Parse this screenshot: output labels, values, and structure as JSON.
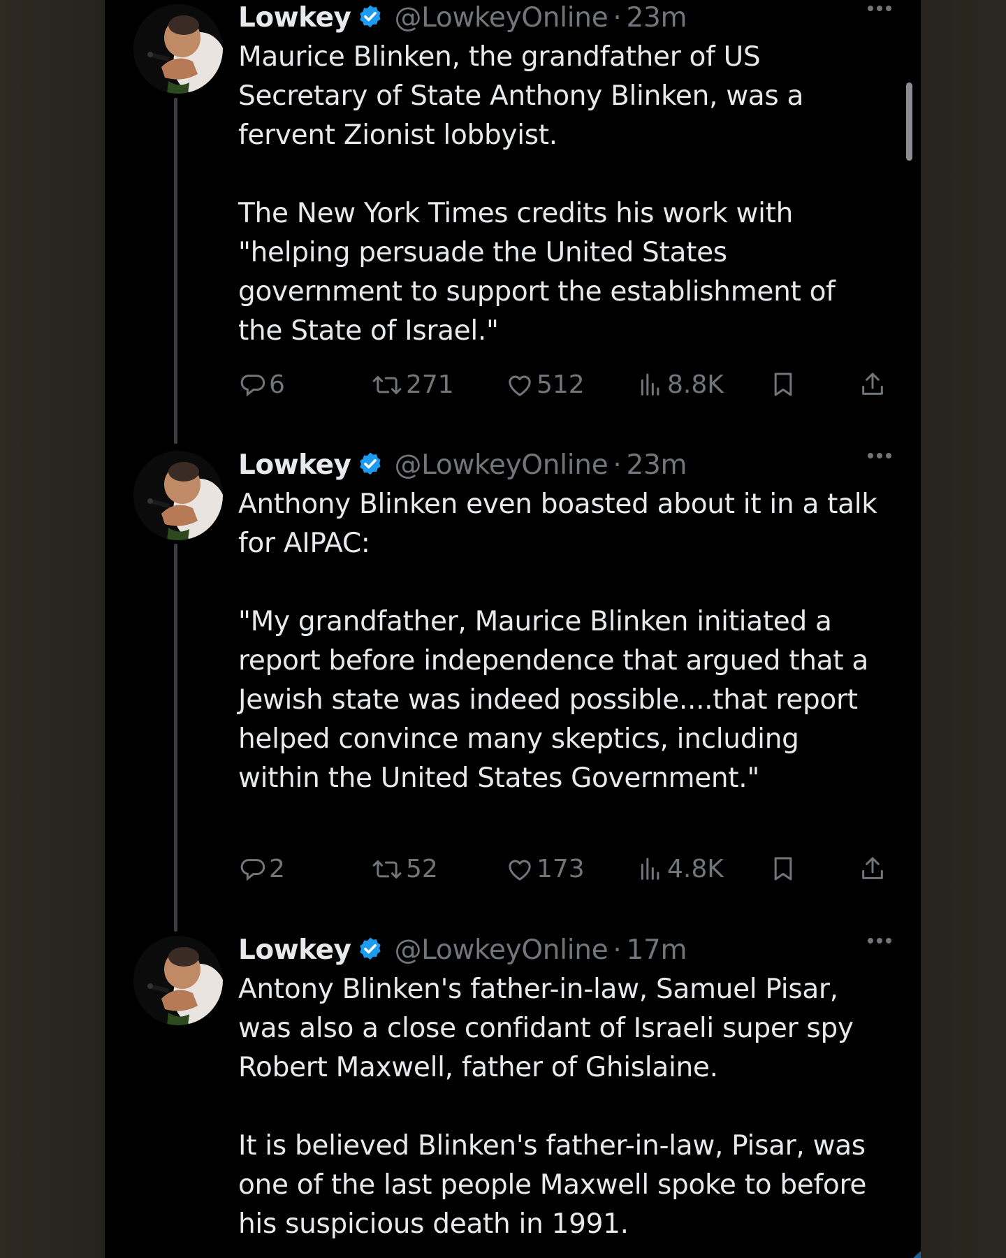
{
  "colors": {
    "background": "#000000",
    "text_primary": "#e7e9ea",
    "text_secondary": "#71767b",
    "verified_blue": "#1d9bf0",
    "thread_line": "#3a3d41"
  },
  "tweets": [
    {
      "author": {
        "name": "Lowkey",
        "handle": "@LowkeyOnline",
        "verified": true
      },
      "separator": "·",
      "time": "23m",
      "paragraphs": [
        "Maurice Blinken, the grandfather of US Secretary of State Anthony Blinken, was a fervent Zionist lobbyist.",
        "The New York Times credits his work with \"helping persuade the United States government to support the establishment of the State of Israel.\""
      ],
      "stats": {
        "replies": "6",
        "reposts": "271",
        "likes": "512",
        "views": "8.8K"
      }
    },
    {
      "author": {
        "name": "Lowkey",
        "handle": "@LowkeyOnline",
        "verified": true
      },
      "separator": "·",
      "time": "23m",
      "paragraphs": [
        "Anthony Blinken even boasted about it in a talk for AIPAC:",
        "\"My grandfather, Maurice Blinken initiated a report before independence that argued that a Jewish state was indeed possible....that report helped convince many skeptics, including within the United States Government.\""
      ],
      "stats": {
        "replies": "2",
        "reposts": "52",
        "likes": "173",
        "views": "4.8K"
      }
    },
    {
      "author": {
        "name": "Lowkey",
        "handle": "@LowkeyOnline",
        "verified": true
      },
      "separator": "·",
      "time": "17m",
      "paragraphs": [
        "Antony Blinken's father-in-law, Samuel Pisar, was also a close confidant of Israeli super spy Robert Maxwell, father of Ghislaine.",
        "It is believed Blinken's father-in-law, Pisar, was one of the last people Maxwell spoke to before his suspicious death in 1991."
      ]
    }
  ],
  "icons": {
    "reply": "reply-icon",
    "repost": "repost-icon",
    "like": "like-icon",
    "views": "views-icon",
    "bookmark": "bookmark-icon",
    "share": "share-icon",
    "more": "more-options-icon",
    "verified": "verified-badge-icon"
  }
}
